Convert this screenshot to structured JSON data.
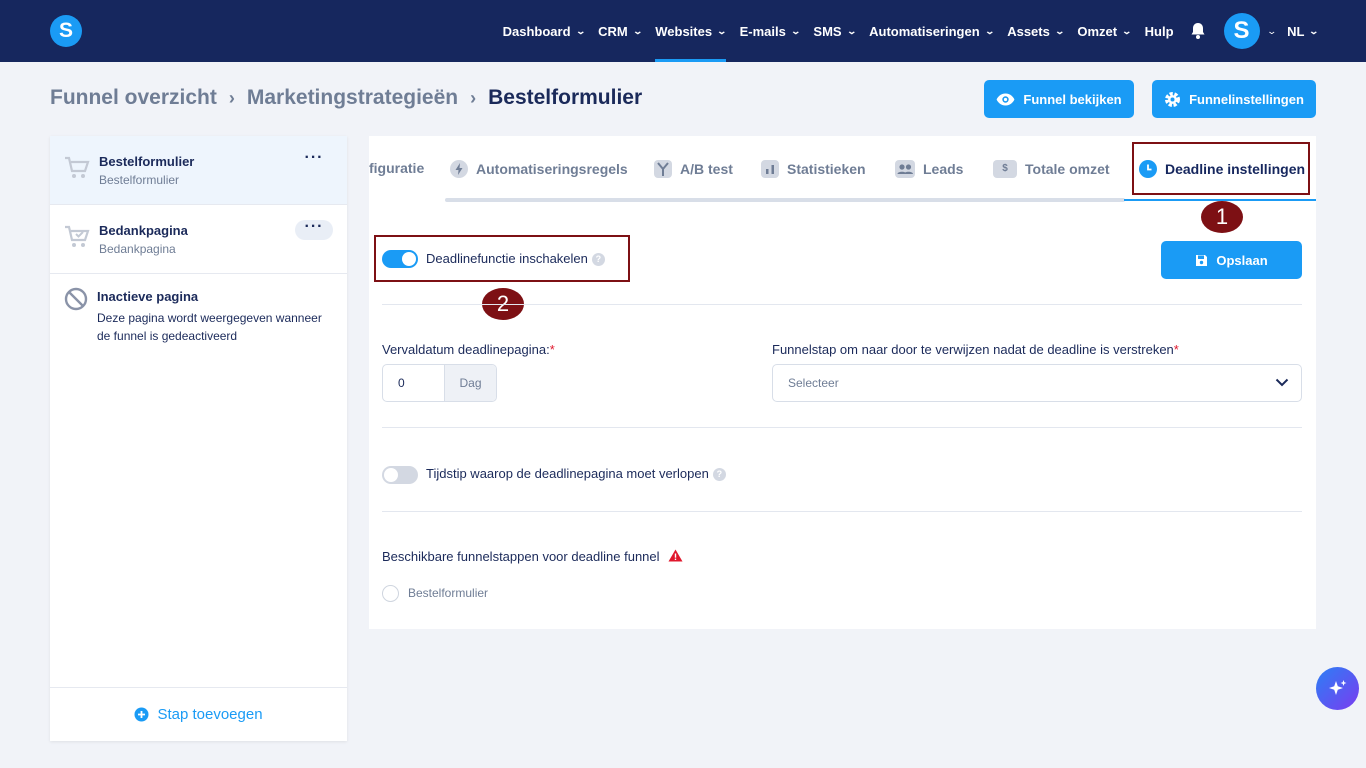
{
  "topnav": {
    "logo_letter": "S",
    "items": [
      {
        "label": "Dashboard",
        "dropdown": true
      },
      {
        "label": "CRM",
        "dropdown": true
      },
      {
        "label": "Websites",
        "dropdown": true,
        "active": true
      },
      {
        "label": "E-mails",
        "dropdown": true
      },
      {
        "label": "SMS",
        "dropdown": true
      },
      {
        "label": "Automatiseringen",
        "dropdown": true
      },
      {
        "label": "Assets",
        "dropdown": true
      },
      {
        "label": "Omzet",
        "dropdown": true
      },
      {
        "label": "Hulp",
        "dropdown": false
      }
    ],
    "avatar_letter": "S",
    "language": "NL",
    "accent_color": "#1a9bf5",
    "bar_color": "#16275e"
  },
  "breadcrumb": {
    "items": [
      "Funnel overzicht",
      "Marketingstrategieën",
      "Bestelformulier"
    ]
  },
  "header_buttons": {
    "view_funnel": "Funnel bekijken",
    "funnel_settings": "Funnelinstellingen"
  },
  "sidebar": {
    "steps": [
      {
        "title": "Bestelformulier",
        "subtitle": "Bestelformulier",
        "active": true
      },
      {
        "title": "Bedankpagina",
        "subtitle": "Bedankpagina",
        "active": false
      }
    ],
    "inactive": {
      "title": "Inactieve pagina",
      "description": "Deze pagina wordt weergegeven wanneer de funnel is gedeactiveerd"
    },
    "add_step": "Stap toevoegen"
  },
  "tabs": {
    "items": [
      {
        "label": "figuratie",
        "icon": "partial-tab"
      },
      {
        "label": "Automatiseringsregels",
        "icon": "bolt-icon"
      },
      {
        "label": "A/B test",
        "icon": "split-icon"
      },
      {
        "label": "Statistieken",
        "icon": "bar-chart-icon"
      },
      {
        "label": "Leads",
        "icon": "users-icon"
      },
      {
        "label": "Totale omzet",
        "icon": "dollar-icon"
      },
      {
        "label": "Deadline instellingen",
        "icon": "clock-icon",
        "active": true
      }
    ]
  },
  "annotations": {
    "one": "1",
    "two": "2"
  },
  "form": {
    "enable_toggle": {
      "label": "Deadlinefunctie inschakelen",
      "on": true
    },
    "save_button": "Opslaan",
    "expiry": {
      "label": "Vervaldatum deadlinepagina:",
      "required_mark": "*",
      "value": "0",
      "unit": "Dag"
    },
    "redirect": {
      "label": "Funnelstap om naar door te verwijzen nadat de deadline is verstreken",
      "required_mark": "*",
      "placeholder": "Selecteer"
    },
    "time_toggle": {
      "label": "Tijdstip waarop de deadlinepagina moet verlopen",
      "on": false
    },
    "available_steps": {
      "label": "Beschikbare funnelstappen voor deadline funnel",
      "options": [
        "Bestelformulier"
      ]
    }
  }
}
